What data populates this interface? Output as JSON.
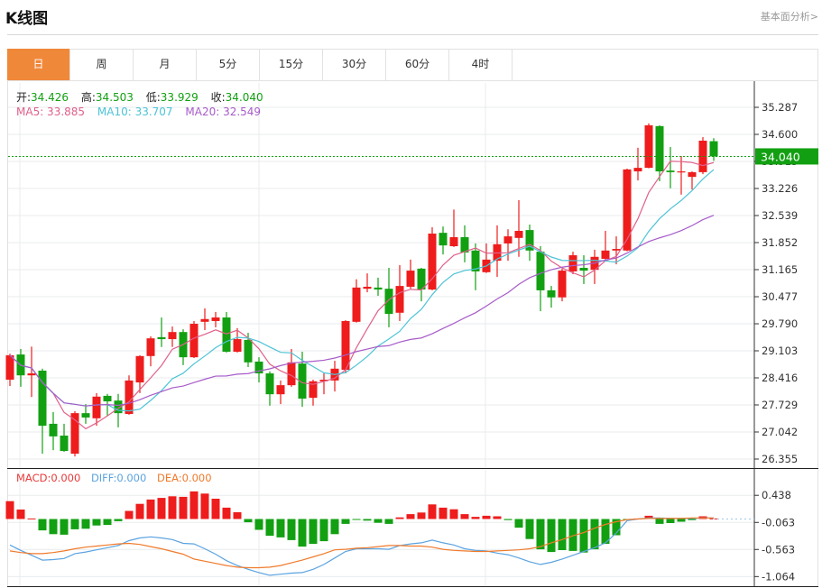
{
  "header": {
    "title": "K线图",
    "link": "基本面分析>"
  },
  "tabs": [
    "日",
    "周",
    "月",
    "5分",
    "15分",
    "30分",
    "60分",
    "4时"
  ],
  "active_tab": 0,
  "ohlc_legend": {
    "open_label": "开:",
    "open": "34.426",
    "high_label": "高:",
    "high": "34.503",
    "low_label": "低:",
    "low": "33.929",
    "close_label": "收:",
    "close": "34.040"
  },
  "ma_legend": {
    "ma5": "MA5: 33.885",
    "ma10": "MA10: 33.707",
    "ma20": "MA20: 32.549"
  },
  "macd_legend": {
    "macd": "MACD:0.000",
    "diff": "DIFF:0.000",
    "dea": "DEA:0.000"
  },
  "colors": {
    "up": "#ee1c1c",
    "down": "#12a012",
    "ma5": "#e0608a",
    "ma10": "#4cc3d6",
    "ma20": "#a75bc9",
    "diff": "#5ba3e0",
    "dea": "#f07a2a",
    "accent": "#f0883a",
    "last_price": "#12a012"
  },
  "chart_data": [
    {
      "type": "candlestick",
      "price_axis": {
        "ylim": [
          26.355,
          35.287
        ],
        "ticks": [
          "35.287",
          "34.600",
          "33.913",
          "33.226",
          "32.539",
          "31.852",
          "31.165",
          "30.477",
          "29.790",
          "29.103",
          "28.416",
          "27.729",
          "27.042",
          "26.355"
        ]
      },
      "last_price": "34.040",
      "ma_periods": [
        5,
        10,
        20
      ],
      "ohlc": [
        [
          28.37,
          29.03,
          28.21,
          28.99
        ],
        [
          29.01,
          29.15,
          28.19,
          28.48
        ],
        [
          28.48,
          29.21,
          27.93,
          28.53
        ],
        [
          28.6,
          28.65,
          26.49,
          27.2
        ],
        [
          27.25,
          27.55,
          26.58,
          26.93
        ],
        [
          26.95,
          27.25,
          26.54,
          26.56
        ],
        [
          26.49,
          27.57,
          26.42,
          27.52
        ],
        [
          27.52,
          27.75,
          27.25,
          27.41
        ],
        [
          27.39,
          28.03,
          27.2,
          27.94
        ],
        [
          27.96,
          28.01,
          27.46,
          27.82
        ],
        [
          27.84,
          28.01,
          27.16,
          27.52
        ],
        [
          27.5,
          28.48,
          27.48,
          28.35
        ],
        [
          28.3,
          28.99,
          28.03,
          28.97
        ],
        [
          28.97,
          29.47,
          28.71,
          29.42
        ],
        [
          29.45,
          29.95,
          29.2,
          29.4
        ],
        [
          29.4,
          29.72,
          29.2,
          29.58
        ],
        [
          29.58,
          29.65,
          28.74,
          28.94
        ],
        [
          28.94,
          29.86,
          28.92,
          29.79
        ],
        [
          29.84,
          30.18,
          29.63,
          29.91
        ],
        [
          29.86,
          30.09,
          29.7,
          29.95
        ],
        [
          29.95,
          30.09,
          29.06,
          29.08
        ],
        [
          29.08,
          29.68,
          29.06,
          29.4
        ],
        [
          29.38,
          29.56,
          28.69,
          28.81
        ],
        [
          28.83,
          28.94,
          28.3,
          28.53
        ],
        [
          28.53,
          28.58,
          27.71,
          28.0
        ],
        [
          28.0,
          28.35,
          27.75,
          28.23
        ],
        [
          28.23,
          29.15,
          28.19,
          28.81
        ],
        [
          28.78,
          29.08,
          27.68,
          27.89
        ],
        [
          27.91,
          28.37,
          27.71,
          28.33
        ],
        [
          28.33,
          28.53,
          28.0,
          28.37
        ],
        [
          28.35,
          28.85,
          28.07,
          28.65
        ],
        [
          28.62,
          29.88,
          28.53,
          29.86
        ],
        [
          29.84,
          30.92,
          29.82,
          30.71
        ],
        [
          30.68,
          31.07,
          30.59,
          30.73
        ],
        [
          30.71,
          30.96,
          30.5,
          30.66
        ],
        [
          30.68,
          31.21,
          29.7,
          30.04
        ],
        [
          30.07,
          31.28,
          29.86,
          30.75
        ],
        [
          30.73,
          31.42,
          30.68,
          31.14
        ],
        [
          31.19,
          31.21,
          30.36,
          30.66
        ],
        [
          30.66,
          32.24,
          30.64,
          32.08
        ],
        [
          32.1,
          32.26,
          31.55,
          31.78
        ],
        [
          31.76,
          32.69,
          31.74,
          31.99
        ],
        [
          31.99,
          32.29,
          31.35,
          31.6
        ],
        [
          31.65,
          31.83,
          30.64,
          31.12
        ],
        [
          31.1,
          31.83,
          31.08,
          31.42
        ],
        [
          31.39,
          32.29,
          30.98,
          31.81
        ],
        [
          31.83,
          32.19,
          31.39,
          32.01
        ],
        [
          31.97,
          32.93,
          31.49,
          32.15
        ],
        [
          32.17,
          32.31,
          31.39,
          31.65
        ],
        [
          31.62,
          31.76,
          30.11,
          30.64
        ],
        [
          30.64,
          30.75,
          30.2,
          30.46
        ],
        [
          30.46,
          31.19,
          30.36,
          31.14
        ],
        [
          31.12,
          31.62,
          31.05,
          31.53
        ],
        [
          31.21,
          31.53,
          30.8,
          31.14
        ],
        [
          31.16,
          31.67,
          30.8,
          31.49
        ],
        [
          31.44,
          32.15,
          31.42,
          31.65
        ],
        [
          31.65,
          32.01,
          31.3,
          31.69
        ],
        [
          31.65,
          33.73,
          31.63,
          33.71
        ],
        [
          33.66,
          34.26,
          33.43,
          33.75
        ],
        [
          33.75,
          34.88,
          33.74,
          34.83
        ],
        [
          34.81,
          34.83,
          33.41,
          33.66
        ],
        [
          33.68,
          34.28,
          33.23,
          33.64
        ],
        [
          33.64,
          34.05,
          33.07,
          33.66
        ],
        [
          33.52,
          33.66,
          33.2,
          33.64
        ],
        [
          33.64,
          34.53,
          33.59,
          34.44
        ],
        [
          34.426,
          34.503,
          33.929,
          34.04
        ]
      ]
    },
    {
      "type": "macd",
      "axis": {
        "ticks": [
          "0.438",
          "-0.063",
          "-0.563",
          "-1.064"
        ]
      },
      "macd": [
        0.33,
        0.175,
        0.01,
        -0.21,
        -0.28,
        -0.29,
        -0.19,
        -0.18,
        -0.12,
        -0.11,
        -0.04,
        0.15,
        0.28,
        0.36,
        0.39,
        0.42,
        0.41,
        0.51,
        0.47,
        0.375,
        0.21,
        0.125,
        -0.06,
        -0.2,
        -0.31,
        -0.34,
        -0.39,
        -0.51,
        -0.46,
        -0.41,
        -0.28,
        -0.09,
        -0.01,
        -0.03,
        -0.07,
        -0.09,
        0.03,
        0.09,
        0.12,
        0.27,
        0.21,
        0.18,
        0.09,
        0.04,
        0.06,
        0.05,
        -0.02,
        -0.16,
        -0.37,
        -0.56,
        -0.61,
        -0.575,
        -0.59,
        -0.62,
        -0.56,
        -0.46,
        -0.3,
        -0.01,
        0.01,
        0.06,
        -0.09,
        -0.075,
        -0.05,
        -0.02,
        0.05,
        0.01
      ],
      "diff": [
        -0.48,
        -0.58,
        -0.67,
        -0.76,
        -0.75,
        -0.73,
        -0.64,
        -0.61,
        -0.57,
        -0.53,
        -0.49,
        -0.4,
        -0.35,
        -0.33,
        -0.35,
        -0.38,
        -0.45,
        -0.46,
        -0.55,
        -0.65,
        -0.77,
        -0.86,
        -0.93,
        -0.99,
        -1.04,
        -1.02,
        -1.0,
        -0.99,
        -0.93,
        -0.84,
        -0.72,
        -0.6,
        -0.55,
        -0.55,
        -0.55,
        -0.56,
        -0.49,
        -0.46,
        -0.44,
        -0.39,
        -0.44,
        -0.48,
        -0.55,
        -0.58,
        -0.59,
        -0.63,
        -0.66,
        -0.72,
        -0.79,
        -0.84,
        -0.8,
        -0.74,
        -0.67,
        -0.6,
        -0.53,
        -0.44,
        -0.26,
        -0.03,
        0.0,
        0.02,
        0.02,
        0.01,
        0.01,
        0.01,
        0.02,
        0.02
      ],
      "dea": [
        -0.59,
        -0.62,
        -0.64,
        -0.64,
        -0.62,
        -0.59,
        -0.55,
        -0.52,
        -0.5,
        -0.48,
        -0.46,
        -0.45,
        -0.47,
        -0.51,
        -0.55,
        -0.6,
        -0.65,
        -0.74,
        -0.78,
        -0.82,
        -0.86,
        -0.89,
        -0.9,
        -0.9,
        -0.89,
        -0.86,
        -0.81,
        -0.76,
        -0.7,
        -0.64,
        -0.57,
        -0.56,
        -0.54,
        -0.53,
        -0.51,
        -0.49,
        -0.49,
        -0.5,
        -0.5,
        -0.52,
        -0.56,
        -0.58,
        -0.59,
        -0.6,
        -0.6,
        -0.59,
        -0.58,
        -0.57,
        -0.55,
        -0.51,
        -0.44,
        -0.38,
        -0.31,
        -0.25,
        -0.17,
        -0.1,
        -0.05,
        -0.01,
        0.0,
        0.01,
        0.01,
        0.01,
        0.01,
        0.02,
        0.02,
        0.02
      ]
    }
  ]
}
